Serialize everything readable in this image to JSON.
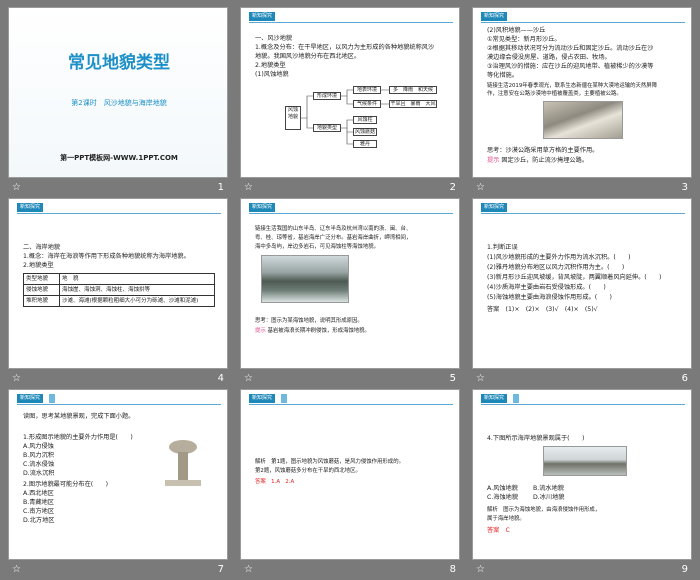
{
  "slides": [
    {
      "num": "1",
      "title": "常见地貌类型",
      "subtitle": "第2课时　风沙地貌与海岸地貌",
      "footer": "第一PPT模板网-WWW.1PPT.COM"
    },
    {
      "num": "2",
      "tab": "新知探究",
      "lines": [
        "一、风沙地貌",
        "1.概念及分布：在干旱地区，以风力为主形成的各种地貌统称风沙",
        "地貌。我国风沙地貌分布在西北地区。",
        "2.地貌类型",
        "(1)风蚀地貌"
      ],
      "diagram": {
        "root": "风蚀地貌",
        "b1": "形成环境",
        "b2": "地貌类型",
        "c1": "地表环境",
        "c2": "气候条件",
        "c3": "风蚀柱",
        "c4": "风蚀蘑菇",
        "c5": "雅丹",
        "d1": "多　降雨　和天候",
        "d2": "干旱且　暴雨　大风"
      }
    },
    {
      "num": "3",
      "tab": "新知探究",
      "lines": [
        "(2)风积地貌——沙丘",
        "①常见类型：新月形沙丘。",
        "②根据其移动状况可分为流动沙丘和固定沙丘。流动沙丘在沙",
        "漠边缘会侵没房屋、道路，侵占农田、牧场。",
        "③治理风沙的措施：应在沙丘的迎风地带、植被稀少的沙漠等",
        "等化措施。"
      ],
      "story": [
        "链接生活2019年春季观光，联系生态新疆在某种大漠地运输的天然屏障",
        "作，注意安在公路沙漠地中植被覆盖类，主要植被公路。"
      ],
      "q": "思考：沙漠公路采用草方格的主要作用。",
      "hint_label": "提示",
      "hint": "固定沙丘，防止流沙掩埋公路。"
    },
    {
      "num": "4",
      "tab": "新知探究",
      "lines": [
        "二、海岸地貌",
        "1.概念：海岸在海浪等作用下形成各种地貌统称为海岸地貌。",
        "2.地貌类型"
      ],
      "table": [
        [
          "类型地貌",
          "地　貌"
        ],
        [
          "侵蚀地貌",
          "海蚀崖、海蚀洞、海蚀柱、海蚀拱等"
        ],
        [
          "堆积地貌",
          "沙滩、海滩(根据颗粒粗细大小可分为砾滩、沙滩和泥滩)"
        ]
      ]
    },
    {
      "num": "5",
      "tab": "新知探究",
      "lines": [
        "链接生活我国的山东半岛、辽东半岛及杭州湾以南的浙、闽、台、",
        "粤、桂、琼等省，基岩海岸广泛分布。基岩海岸曲折，岬湾相间，",
        "海中多岛屿，岸边多岩石，可见海蚀柱等海蚀地貌。"
      ],
      "q": "思考：图示为某海蚀地貌，说明其形成原因。",
      "hint_label": "提示",
      "hint": "基岩被海浪长期冲刷侵蚀，形成海蚀地貌。"
    },
    {
      "num": "6",
      "tab": "新知探究",
      "lines": [
        "1.判断正误",
        "(1)风沙地貌形成的主要外力作用为流水沉积。(　　)",
        "(2)雅丹地貌分布地区以风力沉积作用为主。(　　)",
        "(3)新月形沙丘迎风坡缓，背风坡陡，两翼顺着风向延伸。(　　)",
        "(4)沙质海岸主要由岩石受侵蚀形成。(　　)",
        "(5)海蚀地貌主要由海浪侵蚀作用形成。(　　)"
      ],
      "answer": "答案　(1)×　(2)×　(3)√　(4)×　(5)√"
    },
    {
      "num": "7",
      "tab": "新知探究",
      "lines": [
        "读图，思考某地貌景观，完成下面小题。",
        "1.形成图示地貌的主要外力作用是(　　)",
        "A.风力侵蚀",
        "B.风力沉积",
        "C.流水侵蚀",
        "D.流水沉积",
        "2.图示地貌最可能分布在(　　)",
        "A.西北地区",
        "B.青藏地区",
        "C.南方地区",
        "D.北方地区"
      ]
    },
    {
      "num": "8",
      "tab": "新知探究",
      "lines": [
        "解析　第1题，图示地貌为风蚀蘑菇，是风力侵蚀作用形成的。",
        "第2题，风蚀蘑菇多分布在干旱的西北地区。"
      ],
      "answer": "答案　1.A　2.A"
    },
    {
      "num": "9",
      "tab": "新知探究",
      "lines": [
        "4.下图所示海岸地貌景观属于(　　)"
      ],
      "options": [
        "A.风蚀地貌",
        "B.流水地貌",
        "C.海蚀地貌",
        "D.冰川地貌"
      ],
      "expl": [
        "解析　图示为海蚀地貌，由海浪侵蚀作用形成，",
        "属于海岸地貌。"
      ],
      "answer": "答案　C"
    }
  ],
  "star": "☆"
}
